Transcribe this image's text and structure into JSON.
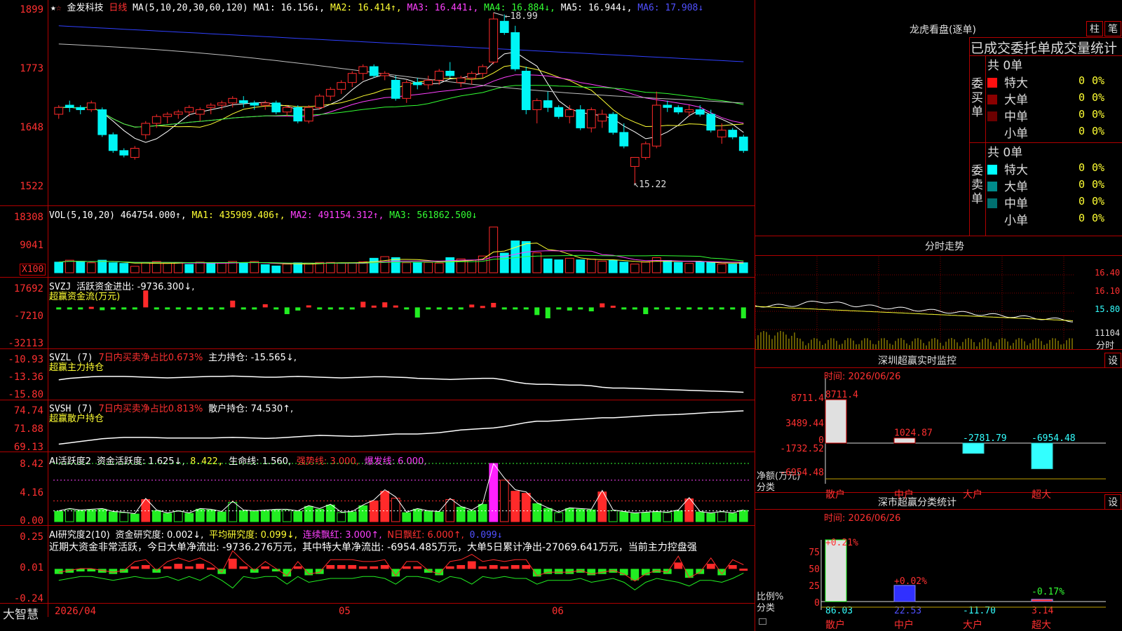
{
  "title_bar": {
    "stock_name": "金发科技",
    "period": "日线",
    "ma_header": "MA(5,10,20,30,60,120)",
    "ma1": "MA1: 16.156↓,",
    "ma2": "MA2: 16.414↑,",
    "ma3": "MA3: 16.441↓,",
    "ma4": "MA4: 16.884↓,",
    "ma5": "MA5: 16.944↓,",
    "ma6": "MA6: 17.908↓"
  },
  "price_panel": {
    "axis_ticks": [
      "1899",
      "1773",
      "1648",
      "1522"
    ],
    "high_label": "18.99",
    "low_label": "15.22"
  },
  "vol_panel": {
    "header": "VOL(5,10,20)",
    "value": "464754.000↑,",
    "ma1": "MA1: 435909.406↑,",
    "ma2": "MA2: 491154.312↑,",
    "ma3": "MA3: 561862.500↓",
    "axis_ticks": [
      "18308",
      "9041"
    ],
    "unit": "X100"
  },
  "svzj_panel": {
    "header": "SVZJ",
    "text": "活跃资金进出: -9736.300↓,",
    "subtitle": "超赢资金流(万元)",
    "axis_ticks": [
      "17692",
      "-7210",
      "-32113"
    ]
  },
  "svzl_panel": {
    "header": "SVZL (7)",
    "text1": "7日内买卖净占比0.673%",
    "text2": "主力持仓: -15.565↓,",
    "subtitle": "超赢主力持仓",
    "axis_ticks": [
      "-10.93",
      "-13.36",
      "-15.80"
    ]
  },
  "svsh_panel": {
    "header": "SVSH (7)",
    "text1": "7日内买卖净占比0.813%",
    "text2": "散户持仓: 74.530↑,",
    "subtitle": "超赢散户持仓",
    "axis_ticks": [
      "74.74",
      "71.88",
      "69.13"
    ]
  },
  "ai_active_panel": {
    "header": "AI活跃度2",
    "t1": "资金活跃度: 1.625↓,",
    "t2": "8.422,",
    "t3": "生命线: 1.560,",
    "t4": "强势线: 3.000,",
    "t5": "爆发线: 6.000,",
    "axis_ticks": [
      "8.42",
      "4.16",
      "0.00"
    ]
  },
  "ai_research_panel": {
    "header": "AI研究度2(10)",
    "t1": "资金研究度: 0.002↓,",
    "t2": "平均研究度: 0.099↓,",
    "t3": "连续飘红: 3.000↑,",
    "t4": "N日飘红: 6.000↑,",
    "t5": "0.099↓",
    "summary": "近期大资金非常活跃，今日大单净流出: -9736.276万元，其中特大单净流出: -6954.485万元，大单5日累计净出-27069.641万元，当前主力控盘强",
    "axis_ticks": [
      "0.25",
      "0.01",
      "-0.24"
    ]
  },
  "bottom_bar": {
    "brand": "大智慧",
    "dates": [
      "2026/04",
      "05",
      "06"
    ]
  },
  "right_panel": {
    "lhkp_title": "龙虎看盘(逐单)",
    "btn_zhu": "柱",
    "btn_bi": "笔",
    "order_title": "已成交委托单成交量统计",
    "buy_group": {
      "side_label": "委买单",
      "total": "共 0单",
      "rows": [
        {
          "name": "特大",
          "count": "0",
          "pct": "0%",
          "color": "#ff1010"
        },
        {
          "name": "大单",
          "count": "0",
          "pct": "0%",
          "color": "#8b0000"
        },
        {
          "name": "中单",
          "count": "0",
          "pct": "0%",
          "color": "#6b0000"
        },
        {
          "name": "小单",
          "count": "0",
          "pct": "0%",
          "color": ""
        }
      ]
    },
    "sell_group": {
      "side_label": "委卖单",
      "total": "共 0单",
      "rows": [
        {
          "name": "特大",
          "count": "0",
          "pct": "0%",
          "color": "#00ffff"
        },
        {
          "name": "大单",
          "count": "0",
          "pct": "0%",
          "color": "#008b8b"
        },
        {
          "name": "中单",
          "count": "0",
          "pct": "0%",
          "color": "#007070"
        },
        {
          "name": "小单",
          "count": "0",
          "pct": "0%",
          "color": ""
        }
      ]
    },
    "intraday": {
      "title": "分时走势",
      "axis_ticks": [
        "16.40",
        "16.10",
        "15.80",
        "11104"
      ],
      "footer": "分时"
    },
    "sz_monitor": {
      "title": "深圳超赢实时监控",
      "btn": "设",
      "time": "时间: 2026/06/26",
      "axis_ticks": [
        "8711.4",
        "3489.44",
        "0",
        "-1732.52",
        "-6954.48"
      ],
      "ylabel1": "净额(万元)",
      "ylabel2": "分类",
      "value_labels": [
        "8711.4",
        "1024.87",
        "-2781.79",
        "-6954.48"
      ],
      "categories": [
        "散户",
        "中户",
        "大户",
        "超大"
      ]
    },
    "sz_class": {
      "title": "深市超赢分类统计",
      "btn": "设",
      "time": "时间: 2026/06/26",
      "axis_ticks": [
        "75",
        "50",
        "25",
        "0"
      ],
      "ylabel1": "比例%",
      "ylabel2": "分类",
      "pct_labels": [
        "+0.21%",
        "+0.02%",
        "-0.17%"
      ],
      "value_labels": [
        "86.03",
        "22.53",
        "-11.70",
        "3.14"
      ],
      "categories": [
        "散户",
        "中户",
        "大户",
        "超大"
      ]
    }
  },
  "chart_data": [
    {
      "type": "candlestick",
      "title": "金发科技 日线",
      "ylim": [
        15.22,
        18.99
      ],
      "ohlc": [
        [
          16.75,
          16.95,
          16.65,
          16.9
        ],
        [
          16.95,
          17.05,
          16.8,
          16.9
        ],
        [
          16.9,
          16.95,
          16.75,
          16.85
        ],
        [
          16.85,
          17.05,
          16.8,
          17.0
        ],
        [
          16.85,
          16.9,
          16.25,
          16.3
        ],
        [
          16.3,
          16.35,
          15.9,
          15.95
        ],
        [
          15.95,
          16.0,
          15.8,
          15.85
        ],
        [
          15.8,
          16.05,
          15.75,
          16.0
        ],
        [
          16.3,
          16.6,
          16.2,
          16.55
        ],
        [
          16.55,
          16.75,
          16.45,
          16.7
        ],
        [
          16.7,
          16.8,
          16.55,
          16.75
        ],
        [
          16.75,
          16.85,
          16.65,
          16.8
        ],
        [
          16.8,
          16.95,
          16.7,
          16.9
        ],
        [
          16.75,
          16.9,
          16.6,
          16.85
        ],
        [
          16.9,
          17.0,
          16.75,
          16.95
        ],
        [
          16.95,
          17.05,
          16.85,
          17.0
        ],
        [
          17.0,
          17.15,
          16.9,
          17.1
        ],
        [
          17.05,
          17.15,
          16.9,
          17.0
        ],
        [
          17.0,
          17.05,
          16.85,
          16.95
        ],
        [
          16.95,
          17.05,
          16.85,
          17.0
        ],
        [
          17.0,
          17.05,
          16.75,
          16.8
        ],
        [
          16.8,
          16.95,
          16.7,
          16.9
        ],
        [
          16.9,
          16.95,
          16.55,
          16.6
        ],
        [
          16.6,
          16.95,
          16.55,
          16.9
        ],
        [
          16.9,
          17.2,
          16.85,
          17.15
        ],
        [
          17.15,
          17.35,
          17.05,
          17.3
        ],
        [
          17.3,
          17.5,
          17.2,
          17.45
        ],
        [
          17.45,
          17.7,
          17.35,
          17.65
        ],
        [
          17.65,
          17.85,
          17.5,
          17.8
        ],
        [
          17.8,
          17.85,
          17.55,
          17.6
        ],
        [
          17.6,
          17.7,
          17.5,
          17.65
        ],
        [
          17.5,
          17.6,
          17.05,
          17.1
        ],
        [
          17.1,
          17.5,
          17.0,
          17.45
        ],
        [
          17.45,
          17.55,
          17.3,
          17.4
        ],
        [
          17.4,
          17.6,
          17.3,
          17.5
        ],
        [
          17.5,
          17.75,
          17.4,
          17.7
        ],
        [
          17.7,
          17.9,
          17.55,
          17.6
        ],
        [
          17.45,
          17.6,
          17.35,
          17.55
        ],
        [
          17.55,
          17.7,
          17.4,
          17.65
        ],
        [
          17.65,
          17.85,
          17.55,
          17.8
        ],
        [
          17.9,
          18.99,
          17.85,
          18.85
        ],
        [
          18.8,
          18.95,
          18.5,
          18.55
        ],
        [
          18.55,
          18.7,
          17.7,
          17.75
        ],
        [
          17.7,
          17.8,
          16.75,
          16.85
        ],
        [
          16.85,
          17.1,
          16.55,
          17.05
        ],
        [
          17.05,
          17.25,
          16.8,
          16.9
        ],
        [
          16.9,
          16.95,
          16.65,
          16.7
        ],
        [
          16.7,
          16.95,
          16.55,
          16.85
        ],
        [
          16.85,
          16.95,
          16.4,
          16.45
        ],
        [
          16.45,
          16.9,
          16.35,
          16.85
        ],
        [
          16.6,
          16.85,
          16.45,
          16.75
        ],
        [
          16.75,
          16.8,
          16.3,
          16.35
        ],
        [
          16.35,
          16.55,
          16.0,
          16.05
        ],
        [
          15.6,
          15.8,
          15.22,
          15.8
        ],
        [
          15.8,
          16.15,
          15.75,
          16.1
        ],
        [
          16.05,
          17.25,
          16.0,
          16.95
        ],
        [
          16.95,
          17.05,
          16.8,
          16.9
        ],
        [
          16.9,
          16.95,
          16.75,
          16.8
        ],
        [
          16.8,
          16.95,
          16.7,
          16.85
        ],
        [
          16.85,
          16.95,
          16.7,
          16.75
        ],
        [
          16.75,
          16.85,
          16.35,
          16.4
        ],
        [
          16.25,
          16.55,
          16.1,
          16.4
        ],
        [
          16.4,
          16.45,
          16.2,
          16.25
        ],
        [
          16.25,
          16.3,
          15.9,
          15.95
        ]
      ],
      "ma_values": {
        "MA1": 16.156,
        "MA2": 16.414,
        "MA3": 16.441,
        "MA4": 16.884,
        "MA5": 16.944,
        "MA6": 17.908
      }
    },
    {
      "type": "bar",
      "title": "VOL(5,10,20)",
      "ylim": [
        0,
        18308
      ],
      "values": [
        3300,
        3900,
        3500,
        3100,
        3900,
        3100,
        2900,
        2000,
        3100,
        3500,
        3000,
        3200,
        2600,
        3300,
        3100,
        3000,
        3500,
        3000,
        3500,
        2500,
        2100,
        2700,
        3100,
        3000,
        3200,
        3200,
        3000,
        3100,
        3400,
        4500,
        5000,
        4700,
        3100,
        3100,
        3200,
        3000,
        4700,
        4300,
        3900,
        5200,
        14200,
        6100,
        9900,
        9700,
        6200,
        4300,
        4000,
        4500,
        4000,
        4200,
        3600,
        3900,
        3300,
        2700,
        3300,
        4700,
        3800,
        3200,
        2900,
        3400,
        3200,
        2700,
        2700,
        3100
      ],
      "up": [
        false,
        true,
        false,
        true,
        false,
        false,
        false,
        true,
        true,
        true,
        true,
        true,
        false,
        true,
        false,
        true,
        true,
        false,
        true,
        false,
        false,
        true,
        false,
        true,
        true,
        true,
        true,
        true,
        true,
        false,
        true,
        false,
        true,
        false,
        true,
        true,
        false,
        true,
        true,
        true,
        true,
        false,
        false,
        false,
        true,
        false,
        false,
        true,
        false,
        true,
        true,
        false,
        false,
        true,
        true,
        true,
        false,
        false,
        true,
        false,
        false,
        true,
        false,
        false
      ]
    },
    {
      "type": "bar",
      "title": "超赢资金流(万元)",
      "ylim": [
        -32113,
        17692
      ],
      "values": [
        -1200,
        -1500,
        -800,
        500,
        -2500,
        -1400,
        -1800,
        -600,
        15000,
        -500,
        -400,
        -300,
        -600,
        -2100,
        -1700,
        -500,
        6000,
        -800,
        -900,
        2800,
        -1000,
        -6000,
        -2800,
        1800,
        -1500,
        -1300,
        -800,
        -1300,
        5000,
        1600,
        4500,
        1700,
        -1800,
        -9000,
        -400,
        -1200,
        -1000,
        -800,
        2500,
        1300,
        4000,
        -1800,
        -1000,
        -700,
        -6800,
        -9700,
        -500,
        -2800,
        -1200,
        -3500,
        3600,
        1500,
        -600,
        -1900,
        -6000,
        -1000,
        -1600,
        -1200,
        -1200,
        -1200,
        -1800,
        -1200,
        -1500,
        -9736.3
      ]
    },
    {
      "type": "line",
      "title": "超赢主力持仓",
      "ylim": [
        -15.8,
        -10.93
      ],
      "values": [
        -13.9,
        -13.7,
        -13.6,
        -13.5,
        -13.45,
        -13.45,
        -13.45,
        -13.5,
        -13.55,
        -13.6,
        -13.65,
        -13.6,
        -13.55,
        -13.5,
        -13.45,
        -13.45,
        -13.4,
        -13.45,
        -13.5,
        -13.55,
        -13.55,
        -13.5,
        -13.45,
        -13.5,
        -13.55,
        -13.6,
        -13.65,
        -13.6,
        -13.55,
        -13.5,
        -13.5,
        -13.55,
        -13.6,
        -13.7,
        -13.75,
        -13.8,
        -13.85,
        -13.8,
        -13.75,
        -13.7,
        -13.7,
        -13.9,
        -14.2,
        -14.4,
        -14.5,
        -14.5,
        -14.55,
        -14.6,
        -14.6,
        -14.7,
        -14.9,
        -15.0,
        -15.0,
        -15.05,
        -15.1,
        -15.15,
        -15.2,
        -15.25,
        -15.3,
        -15.35,
        -15.4,
        -15.45,
        -15.5,
        -15.565
      ]
    },
    {
      "type": "line",
      "title": "超赢散户持仓",
      "ylim": [
        69.13,
        74.74
      ],
      "values": [
        69.6,
        69.8,
        70.0,
        70.2,
        70.4,
        70.5,
        70.6,
        70.6,
        70.6,
        70.55,
        70.5,
        70.5,
        70.5,
        70.5,
        70.5,
        70.55,
        70.6,
        70.55,
        70.5,
        70.45,
        70.5,
        70.6,
        70.7,
        70.8,
        70.9,
        70.85,
        70.8,
        70.75,
        70.8,
        70.9,
        71.0,
        71.1,
        71.1,
        71.1,
        71.2,
        71.3,
        71.5,
        71.7,
        71.8,
        71.9,
        72.0,
        72.2,
        72.5,
        72.8,
        73.0,
        73.0,
        73.1,
        73.2,
        73.3,
        73.4,
        73.5,
        73.5,
        73.6,
        73.7,
        73.8,
        73.9,
        73.95,
        74.0,
        74.1,
        74.2,
        74.3,
        74.35,
        74.45,
        74.53
      ]
    },
    {
      "type": "bar",
      "title": "AI活跃度2",
      "ylim": [
        0,
        8.42
      ],
      "values": [
        1.5,
        1.8,
        1.6,
        1.7,
        1.8,
        1.4,
        1.3,
        1.1,
        3.2,
        1.6,
        1.2,
        1.5,
        1.2,
        1.8,
        1.7,
        1.4,
        2.8,
        1.6,
        1.5,
        1.6,
        1.7,
        1.7,
        1.5,
        2.2,
        1.8,
        2.4,
        1.3,
        1.4,
        2.3,
        3.0,
        4.4,
        3.4,
        1.3,
        1.8,
        1.5,
        1.4,
        3.2,
        2.1,
        1.6,
        2.5,
        8.42,
        6.0,
        4.4,
        4.1,
        2.6,
        1.9,
        1.3,
        1.9,
        1.8,
        1.7,
        4.3,
        1.6,
        1.4,
        1.2,
        1.3,
        1.4,
        1.3,
        1.6,
        3.3,
        1.4,
        1.2,
        1.4,
        1.2,
        1.625
      ],
      "lines": {
        "生命线": 1.56,
        "强势线": 3.0,
        "爆发线": 6.0
      }
    },
    {
      "type": "bar",
      "title": "AI研究度2(10)",
      "ylim": [
        -0.24,
        0.25
      ],
      "values": [
        -0.04,
        -0.03,
        -0.02,
        -0.02,
        -0.03,
        -0.04,
        -0.03,
        0.02,
        0.03,
        -0.03,
        0.02,
        0.04,
        0.02,
        0.04,
        0.01,
        -0.04,
        0.08,
        0.02,
        -0.03,
        0.02,
        -0.02,
        -0.06,
        0.02,
        -0.05,
        -0.04,
        0.03,
        0.03,
        0.03,
        0.02,
        0.02,
        0.03,
        -0.06,
        0.02,
        0.02,
        -0.03,
        -0.05,
        0.02,
        0.03,
        0.06,
        0.02,
        0.03,
        0.02,
        0.03,
        0.03,
        -0.06,
        -0.04,
        -0.04,
        -0.04,
        -0.03,
        -0.05,
        -0.04,
        -0.03,
        -0.05,
        -0.09,
        -0.05,
        -0.03,
        -0.04,
        0.05,
        -0.07,
        -0.04,
        0.04,
        -0.05,
        0.03,
        0.002
      ]
    }
  ]
}
